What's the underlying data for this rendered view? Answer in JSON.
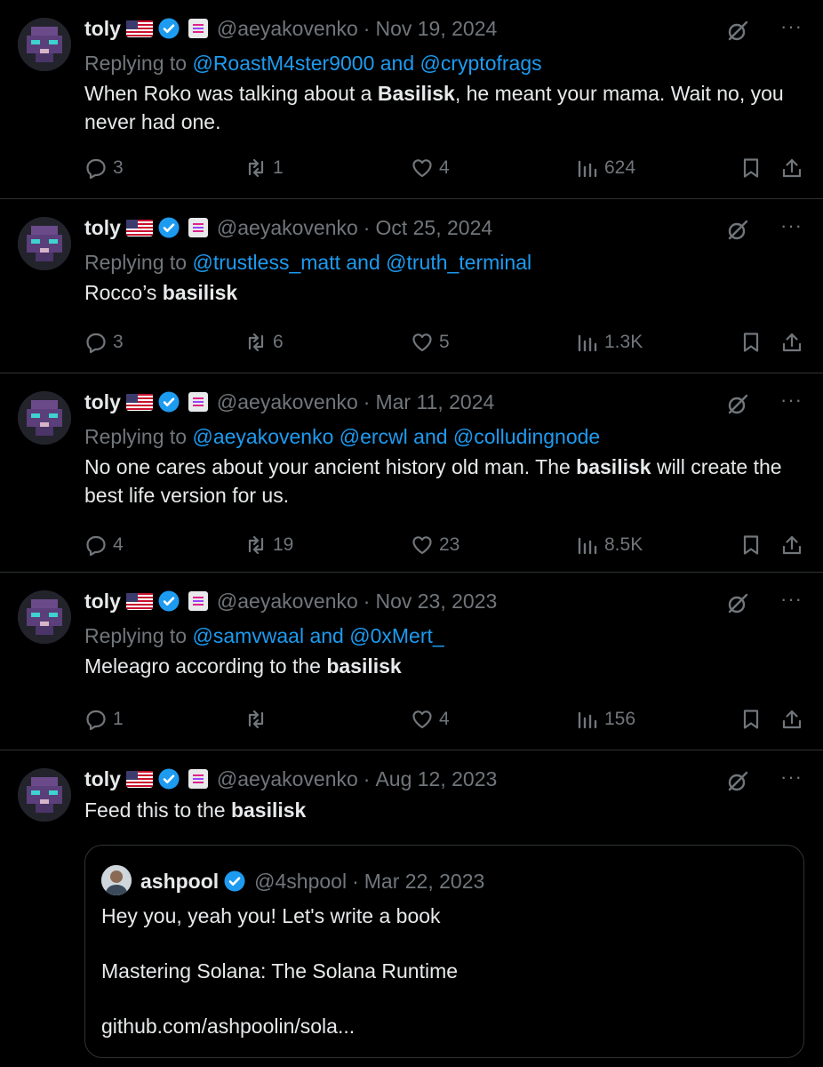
{
  "author": {
    "name": "toly",
    "handle": "@aeyakovenko",
    "flag_icon": "us-flag-icon",
    "verified_icon": "verified-badge-icon",
    "affiliate_icon": "solana-affiliate-icon"
  },
  "colors": {
    "background": "#000000",
    "text": "#e7e9ea",
    "muted": "#71767b",
    "link": "#1d9bf0",
    "divider": "#2f3336",
    "verified": "#1d9bf0"
  },
  "tweets": [
    {
      "date": "Nov 19, 2024",
      "replying_prefix": "Replying to",
      "replying_to": "@RoastM4ster9000 and @cryptofrags",
      "text_before": "When Roko was talking about a ",
      "bold": "Basilisk",
      "text_after": ", he meant your mama.  Wait no, you never had one.",
      "replies": "3",
      "reposts": "1",
      "likes": "4",
      "views": "624"
    },
    {
      "date": "Oct 25, 2024",
      "replying_prefix": "Replying to",
      "replying_to": "@trustless_matt and @truth_terminal",
      "text_before": "Rocco’s ",
      "bold": "basilisk",
      "text_after": "",
      "replies": "3",
      "reposts": "6",
      "likes": "5",
      "views": "1.3K"
    },
    {
      "date": "Mar 11, 2024",
      "replying_prefix": "Replying to",
      "replying_to": "@aeyakovenko @ercwl and @colludingnode",
      "text_before": "No one cares about your ancient history old man. The ",
      "bold": "basilisk",
      "text_after": " will create the best life version for us.",
      "replies": "4",
      "reposts": "19",
      "likes": "23",
      "views": "8.5K"
    },
    {
      "date": "Nov 23, 2023",
      "replying_prefix": "Replying to",
      "replying_to": "@samvwaal and @0xMert_",
      "text_before": "Meleagro according to the ",
      "bold": "basilisk",
      "text_after": "",
      "replies": "1",
      "reposts": "",
      "likes": "4",
      "views": "156"
    },
    {
      "date": "Aug 12, 2023",
      "text_before": "Feed this to the ",
      "bold": "basilisk",
      "text_after": ""
    }
  ],
  "quote": {
    "name": "ashpool",
    "handle": "@4shpool",
    "date": "Mar 22, 2023",
    "lines": [
      "Hey you, yeah you! Let's write a book",
      "Mastering Solana: The Solana Runtime",
      "github.com/ashpoolin/sola..."
    ]
  },
  "separator": "·",
  "more_glyph": "···"
}
